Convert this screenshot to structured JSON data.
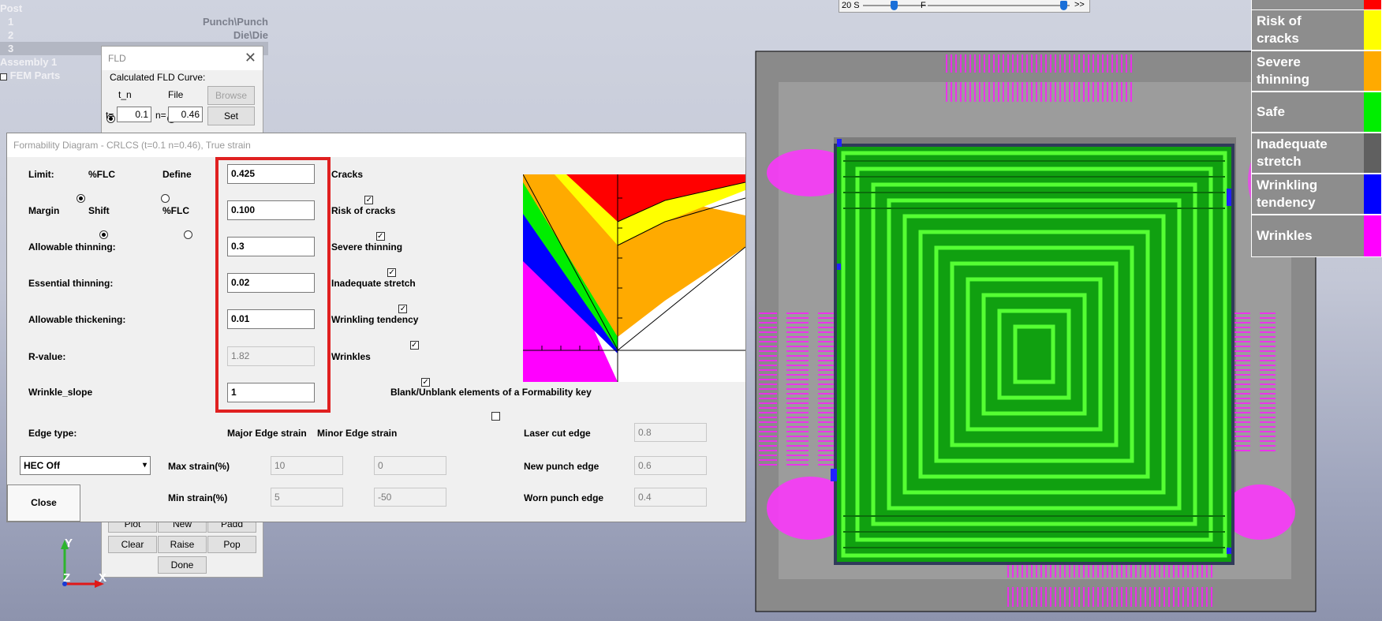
{
  "tree": {
    "title": "Post",
    "items": [
      {
        "num": "1",
        "part": "Punch\\Punch"
      },
      {
        "num": "2",
        "part": "Die\\Die"
      },
      {
        "num": "3",
        "part": ""
      }
    ],
    "assembly": "Assembly 1",
    "fem_parts": "FEM Parts"
  },
  "toolbar": {
    "left_label": "20 S",
    "mid_label": "F",
    "right_label": ">>"
  },
  "fld_window": {
    "title": "FLD",
    "calc_label": "Calculated FLD Curve:",
    "opt_tn": "t_n",
    "opt_file": "File",
    "browse": "Browse",
    "t_label": "t=",
    "t_value": "0.1",
    "n_label": "n=",
    "n_value": "0.46",
    "set": "Set",
    "buttons": [
      "Plot",
      "New",
      "Padd",
      "Clear",
      "Raise",
      "Pop",
      "Done"
    ]
  },
  "dialog": {
    "title": "Formability Diagram - CRLCS (t=0.1 n=0.46), True strain",
    "limit_label": "Limit:",
    "limit_opt1": "%FLC",
    "limit_opt2": "Define",
    "margin_label": "Margin",
    "margin_opt1": "Shift",
    "margin_opt2": "%FLC",
    "fields": [
      {
        "label": "Limit:",
        "value": "0.425",
        "check": "Cracks"
      },
      {
        "label": "Margin",
        "value": "0.100",
        "check": "Risk of cracks"
      },
      {
        "label": "Allowable thinning:",
        "value": "0.3",
        "check": "Severe thinning"
      },
      {
        "label": "Essential thinning:",
        "value": "0.02",
        "check": "Inadequate stretch"
      },
      {
        "label": "Allowable thickening:",
        "value": "0.01",
        "check": "Wrinkling tendency"
      },
      {
        "label": "R-value:",
        "value": "1.82",
        "check": "Wrinkles"
      },
      {
        "label": "Wrinkle_slope",
        "value": "1",
        "check": ""
      }
    ],
    "blank_label": "Blank/Unblank elements of a Formability key",
    "edge_type_label": "Edge type:",
    "major_edge": "Major Edge strain",
    "minor_edge": "Minor Edge strain",
    "hec_select": "HEC Off",
    "max_strain_label": "Max strain(%)",
    "max_major": "10",
    "max_minor": "0",
    "min_strain_label": "Min strain(%)",
    "min_major": "5",
    "min_minor": "-50",
    "laser_label": "Laser cut edge",
    "laser_value": "0.8",
    "new_punch_label": "New punch edge",
    "new_punch_value": "0.6",
    "worn_punch_label": "Worn punch edge",
    "worn_punch_value": "0.4",
    "close": "Close"
  },
  "legend": [
    {
      "label": "",
      "color": "#ff0000"
    },
    {
      "label": "Risk of cracks",
      "color": "#ffff00"
    },
    {
      "label": "Severe thinning",
      "color": "#ffaa00"
    },
    {
      "label": "Safe",
      "color": "#00ee00"
    },
    {
      "label": "Inadequate stretch",
      "color": "#606060"
    },
    {
      "label": "Wrinkling tendency",
      "color": "#0000ff"
    },
    {
      "label": "Wrinkles",
      "color": "#ff00ff"
    }
  ],
  "axes": {
    "y": "Y",
    "z": "Z",
    "x": "X"
  }
}
